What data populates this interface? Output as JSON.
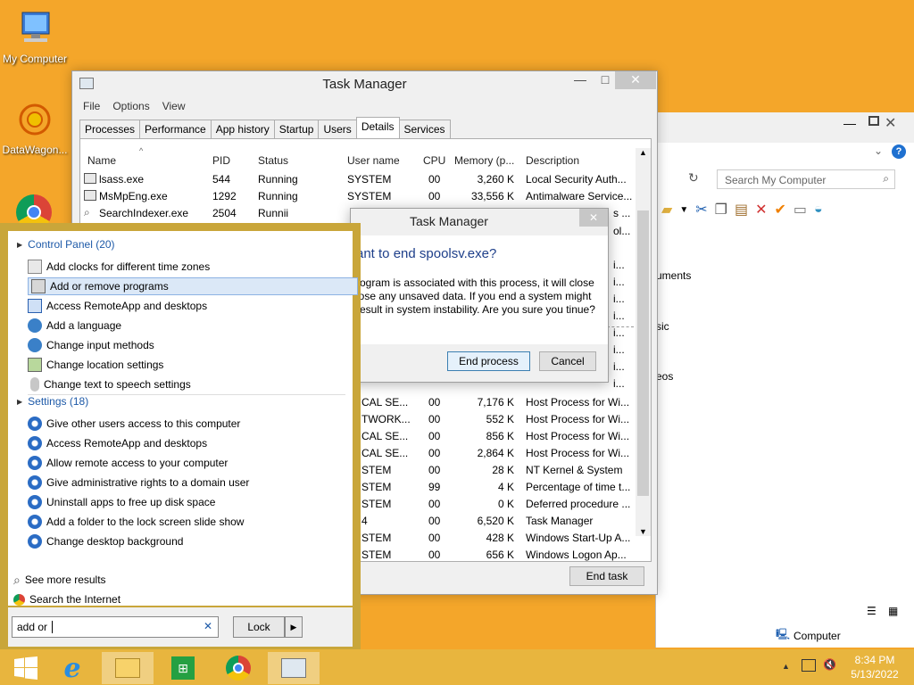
{
  "desktop": {
    "icons": [
      {
        "label": "My Computer"
      },
      {
        "label": "DataWagon..."
      }
    ]
  },
  "explorer": {
    "search_placeholder": "Search My Computer",
    "items": [
      "uments",
      "sic",
      "eos"
    ],
    "status_computer": "Computer"
  },
  "task_manager": {
    "title": "Task Manager",
    "menu": [
      "File",
      "Options",
      "View"
    ],
    "tabs": [
      "Processes",
      "Performance",
      "App history",
      "Startup",
      "Users",
      "Details",
      "Services"
    ],
    "active_tab": "Details",
    "columns": [
      "Name",
      "PID",
      "Status",
      "User name",
      "CPU",
      "Memory (p...",
      "Description"
    ],
    "rows_top": [
      {
        "name": "lsass.exe",
        "pid": "544",
        "status": "Running",
        "user": "SYSTEM",
        "cpu": "00",
        "mem": "3,260 K",
        "desc": "Local Security Auth..."
      },
      {
        "name": "MsMpEng.exe",
        "pid": "1292",
        "status": "Running",
        "user": "SYSTEM",
        "cpu": "00",
        "mem": "33,556 K",
        "desc": "Antimalware Service..."
      },
      {
        "name": "SearchIndexer.exe",
        "pid": "2504",
        "status": "Runnii",
        "user": "",
        "cpu": "",
        "mem": "",
        "desc": "s ..."
      }
    ],
    "rows_partial_desc": [
      "ol...",
      "i...",
      "i...",
      "i...",
      "i...",
      "i...",
      "i...",
      "i...",
      "i..."
    ],
    "rows_bottom": [
      {
        "user": "CAL SE...",
        "cpu": "00",
        "mem": "7,176 K",
        "desc": "Host Process for Wi..."
      },
      {
        "user": "TWORK...",
        "cpu": "00",
        "mem": "552 K",
        "desc": "Host Process for Wi..."
      },
      {
        "user": "CAL SE...",
        "cpu": "00",
        "mem": "856 K",
        "desc": "Host Process for Wi..."
      },
      {
        "user": "CAL SE...",
        "cpu": "00",
        "mem": "2,864 K",
        "desc": "Host Process for Wi..."
      },
      {
        "user": "STEM",
        "cpu": "00",
        "mem": "28 K",
        "desc": "NT Kernel & System"
      },
      {
        "user": "STEM",
        "cpu": "99",
        "mem": "4 K",
        "desc": "Percentage of time t..."
      },
      {
        "user": "STEM",
        "cpu": "00",
        "mem": "0 K",
        "desc": "Deferred procedure ..."
      },
      {
        "user": "4",
        "cpu": "00",
        "mem": "6,520 K",
        "desc": "Task Manager"
      },
      {
        "user": "STEM",
        "cpu": "00",
        "mem": "428 K",
        "desc": "Windows Start-Up A..."
      },
      {
        "user": "STEM",
        "cpu": "00",
        "mem": "656 K",
        "desc": "Windows Logon Ap..."
      }
    ],
    "end_task": "End task"
  },
  "dialog": {
    "title": "Task Manager",
    "heading": "ant to end spoolsv.exe?",
    "body": "rogram is associated with this process, it will close lose any unsaved data. If you end a system might result in system instability. Are you sure you tinue?",
    "end_process": "End process",
    "cancel": "Cancel"
  },
  "search_panel": {
    "group_cp": "Control Panel (20)",
    "cp_items": [
      "Add clocks for different time zones",
      "Add or remove programs",
      "Access RemoteApp and desktops",
      "Add a language",
      "Change input methods",
      "Change location settings",
      "Change text to speech settings"
    ],
    "group_settings": "Settings (18)",
    "settings_items": [
      "Give other users access to this computer",
      "Access RemoteApp and desktops",
      "Allow remote access to your computer",
      "Give administrative rights to a domain user",
      "Uninstall apps to free up disk space",
      "Add a folder to the lock screen slide show",
      "Change desktop background"
    ],
    "see_more": "See more results",
    "search_internet": "Search the Internet",
    "query": "add or",
    "lock": "Lock"
  },
  "taskbar": {
    "time": "8:34 PM",
    "date": "5/13/2022"
  }
}
